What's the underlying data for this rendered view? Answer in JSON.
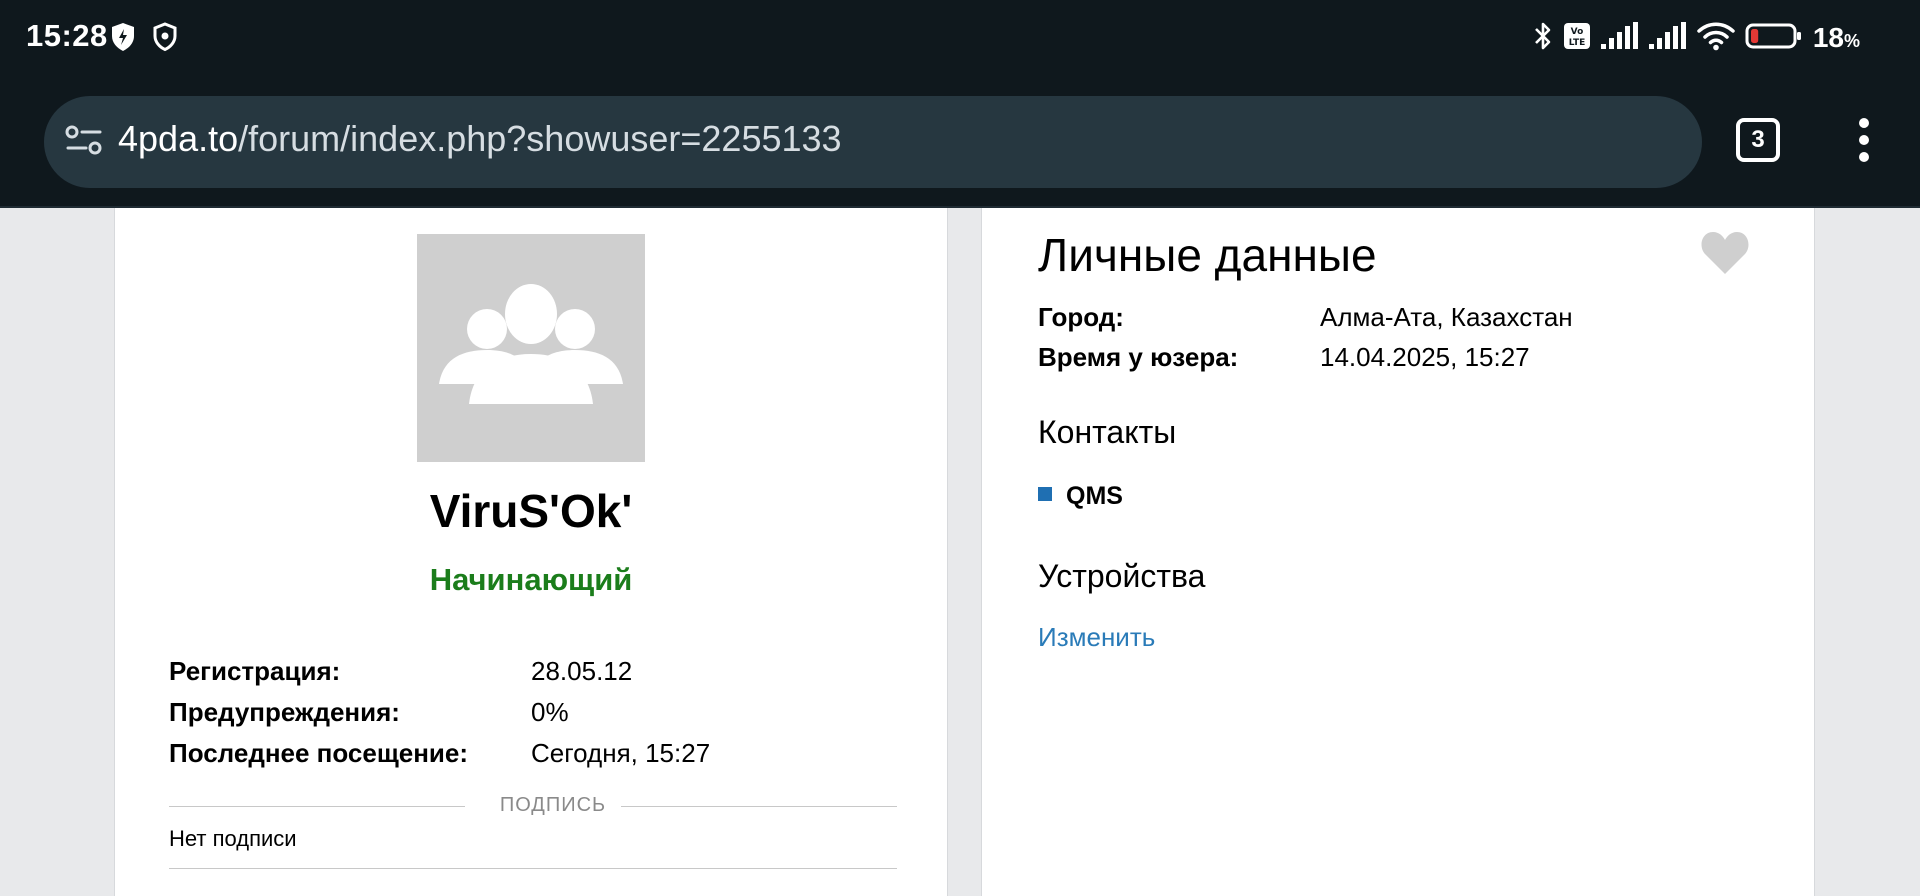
{
  "status_bar": {
    "time": "15:28",
    "battery_percent": "18",
    "battery_unit": "%",
    "battery_level": 0.18,
    "icons": [
      "shield-bolt-icon",
      "shield-icon",
      "bluetooth-icon",
      "volte-icon",
      "signal-icon",
      "signal-icon",
      "wifi-icon",
      "battery-icon"
    ],
    "battery_color": "#e53935"
  },
  "browser": {
    "url_host": "4pda.to",
    "url_path": "/forum/index.php?showuser=2255133",
    "tab_count": "3"
  },
  "profile": {
    "username": "ViruS'Ok'",
    "rank": "Начинающий",
    "rank_color": "#1b7d1b",
    "info": [
      {
        "label": "Регистрация:",
        "value": "28.05.12"
      },
      {
        "label": "Предупреждения:",
        "value": "0%"
      },
      {
        "label": "Последнее посещение:",
        "value": "Сегодня, 15:27"
      }
    ],
    "signature_title": "ПОДПИСЬ",
    "signature_text": "Нет подписи"
  },
  "personal": {
    "title": "Личные данные",
    "rows": [
      {
        "label": "Город:",
        "value": "Алма-Ата, Казахстан"
      },
      {
        "label": "Время у юзера:",
        "value": "14.04.2025, 15:27"
      }
    ],
    "contacts_title": "Контакты",
    "contacts": [
      "QMS"
    ],
    "devices_title": "Устройства",
    "change_link": "Изменить",
    "link_color": "#2a7bb8"
  }
}
